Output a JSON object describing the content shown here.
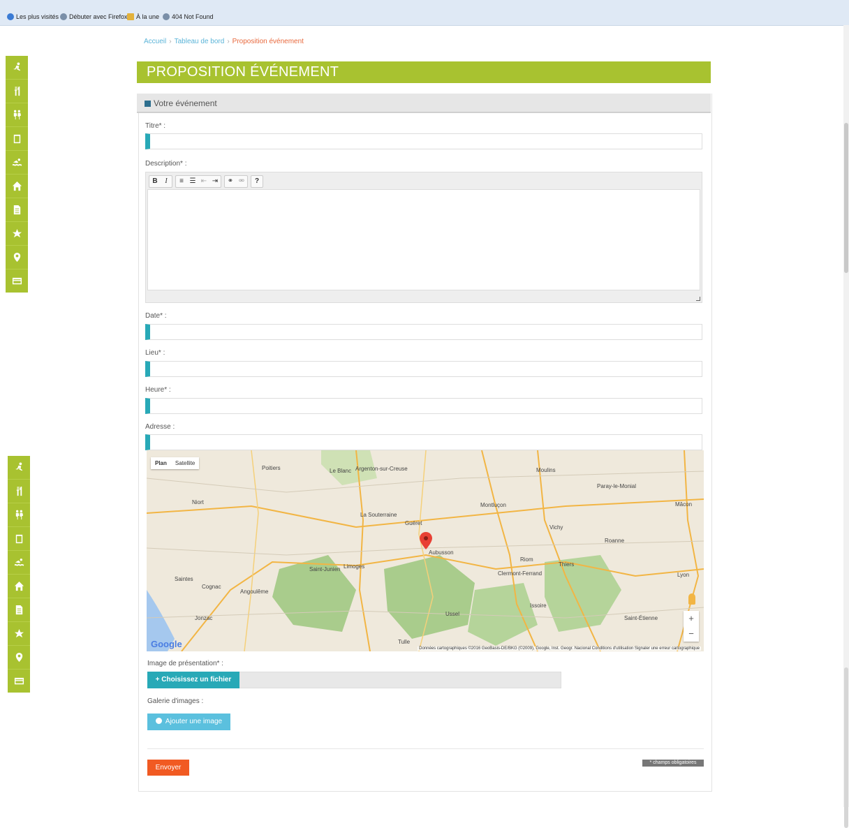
{
  "bookmarks": [
    {
      "label": "Les plus visités",
      "color": "#3b7bd4"
    },
    {
      "label": "Débuter avec Firefox",
      "color": "#7a8fa8"
    },
    {
      "label": "À la une",
      "color": "#e3b23c"
    },
    {
      "label": "404 Not Found",
      "color": "#7a8fa8"
    }
  ],
  "sidebar_icons": [
    "runner-icon",
    "restaurant-icon",
    "hiking-icon",
    "calendar-icon",
    "swimming-icon",
    "home-icon",
    "document-icon",
    "star-icon",
    "map-pin-icon",
    "card-icon"
  ],
  "breadcrumb": {
    "home": "Accueil",
    "dashboard": "Tableau de bord",
    "current": "Proposition événement"
  },
  "page": {
    "title": "PROPOSITION ÉVÉNEMENT"
  },
  "panel": {
    "header": "Votre événement"
  },
  "form": {
    "title_label": "Titre* :",
    "description_label": "Description* :",
    "date_label": "Date* :",
    "lieu_label": "Lieu* :",
    "heure_label": "Heure* :",
    "adresse_label": "Adresse :",
    "image_label": "Image de présentation* :",
    "file_button": "+ Choisissez un fichier",
    "gallery_label": "Galerie d'images :",
    "add_image_button": "Ajouter une image",
    "submit_button": "Envoyer",
    "required_note": "* champs obligatoires"
  },
  "editor_toolbar": {
    "bold": "B",
    "italic": "I",
    "help": "?"
  },
  "map": {
    "tab_plan": "Plan",
    "tab_satellite": "Satellite",
    "logo": "Google",
    "attribution": "Données cartographiques ©2016 GeoBasis-DE/BKG (©2009), Google, Inst. Geogr. Nacional   Conditions d'utilisation   Signaler une erreur cartographique",
    "zoom_in": "+",
    "zoom_out": "−",
    "cities": [
      "Poitiers",
      "Niort",
      "Montluçon",
      "Moulins",
      "Paray-le-Monial",
      "Guéret",
      "Aubusson",
      "Vichy",
      "Roanne",
      "Limoges",
      "Riom",
      "Thiers",
      "Clermont-Ferrand",
      "Saintes",
      "Cognac",
      "Angoulême",
      "Ussel",
      "Issoire",
      "Saint-Étienne",
      "Lyon",
      "Mâcon",
      "Tulle",
      "Jonzac",
      "Le Blanc",
      "Argenton-sur-Creuse",
      "La Souterraine",
      "Saint-Junien"
    ]
  }
}
